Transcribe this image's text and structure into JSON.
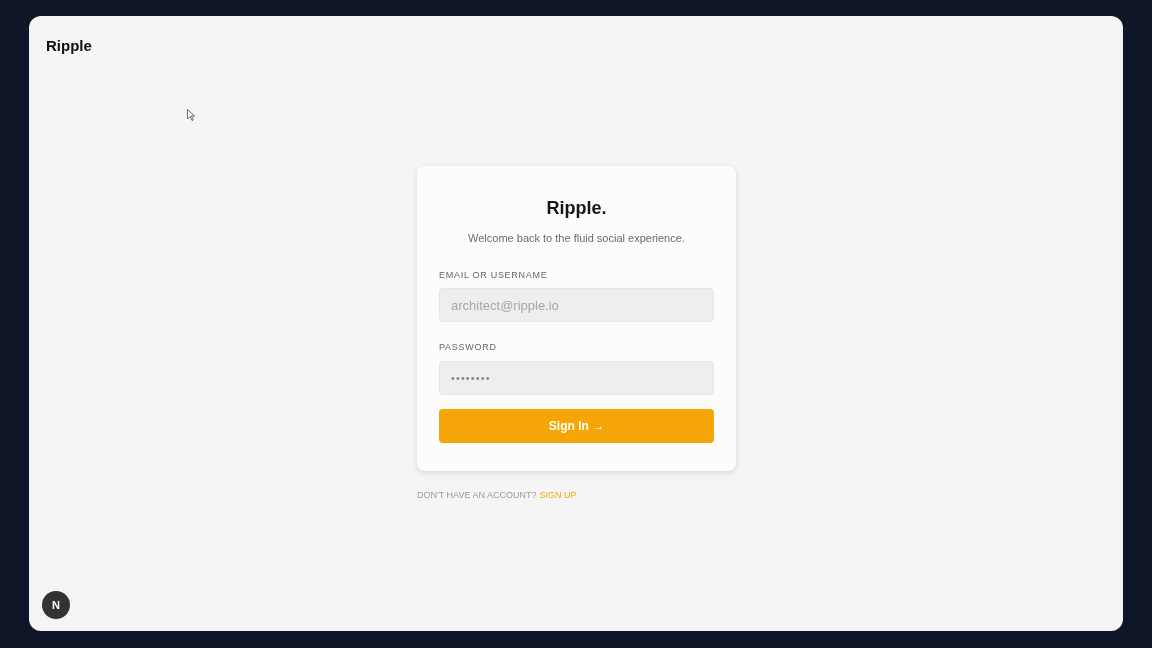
{
  "brand": "Ripple",
  "card": {
    "title": "Ripple.",
    "subtitle": "Welcome back to the fluid social experience.",
    "fields": [
      {
        "label": "EMAIL OR USERNAME",
        "placeholder": "architect@ripple.io",
        "kind": "text"
      },
      {
        "label": "PASSWORD",
        "placeholder": "••••••••",
        "kind": "password"
      }
    ],
    "button": "Sign In →"
  },
  "footer": {
    "prompt": "DON'T HAVE AN ACCOUNT?",
    "link": "SIGN UP"
  },
  "dev_badge": "N"
}
